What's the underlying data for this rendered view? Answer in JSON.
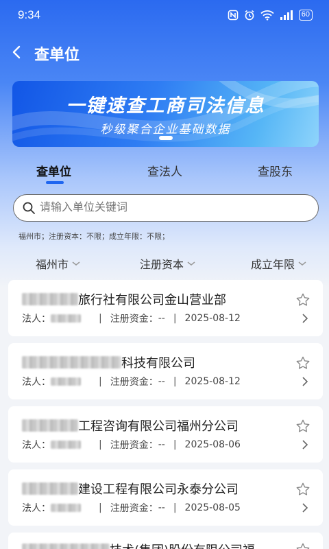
{
  "status_bar": {
    "time": "9:34",
    "battery": "60"
  },
  "nav": {
    "title": "查单位"
  },
  "banner": {
    "title": "一键速查工商司法信息",
    "subtitle": "秒级聚合企业基础数据"
  },
  "tabs": [
    {
      "label": "查单位",
      "active": true
    },
    {
      "label": "查法人",
      "active": false
    },
    {
      "label": "查股东",
      "active": false
    }
  ],
  "search": {
    "placeholder": "请输入单位关键词"
  },
  "filter_summary": "福州市；注册资本：不限；成立年限：不限；",
  "filters": [
    {
      "label": "福州市"
    },
    {
      "label": "注册资本"
    },
    {
      "label": "成立年限"
    }
  ],
  "companies": [
    {
      "name": "旅行社有限公司金山营业部",
      "legal_label": "法人：",
      "capital_label": "注册资金：",
      "capital": "--",
      "date": "2025-08-12"
    },
    {
      "name": "科技有限公司",
      "legal_label": "法人：",
      "capital_label": "注册资金：",
      "capital": "--",
      "date": "2025-08-12"
    },
    {
      "name": "工程咨询有限公司福州分公司",
      "legal_label": "法人：",
      "capital_label": "注册资金：",
      "capital": "--",
      "date": "2025-08-06"
    },
    {
      "name": "建设工程有限公司永泰分公司",
      "legal_label": "法人：",
      "capital_label": "注册资金：",
      "capital": "--",
      "date": "2025-08-05"
    },
    {
      "name": "技术(集团)股份有限公司福"
    }
  ]
}
